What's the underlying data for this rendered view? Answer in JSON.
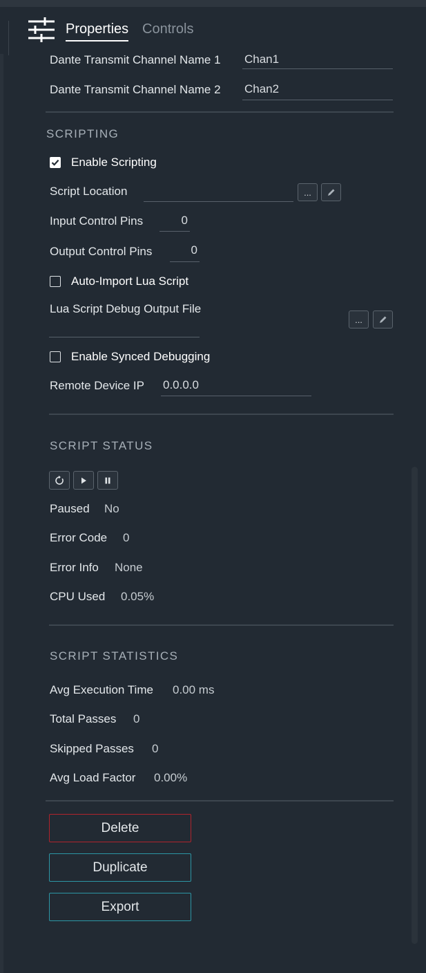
{
  "header": {
    "tabs": [
      "Properties",
      "Controls"
    ],
    "icon": "sliders-icon"
  },
  "dante": {
    "channel1": {
      "label": "Dante Transmit Channel Name 1",
      "value": "Chan1"
    },
    "channel2": {
      "label": "Dante Transmit Channel Name 2",
      "value": "Chan2"
    }
  },
  "scripting": {
    "title": "SCRIPTING",
    "enable_scripting": {
      "label": "Enable Scripting",
      "checked": true
    },
    "script_location": {
      "label": "Script Location",
      "value": "",
      "browse": "...",
      "edit_icon": "pencil-icon"
    },
    "input_pins": {
      "label": "Input Control Pins",
      "value": "0"
    },
    "output_pins": {
      "label": "Output Control Pins",
      "value": "0"
    },
    "auto_import": {
      "label": "Auto-Import Lua Script",
      "checked": false
    },
    "debug_output": {
      "label": "Lua Script Debug Output File",
      "value": "",
      "browse": "...",
      "edit_icon": "pencil-icon"
    },
    "synced_debugging": {
      "label": "Enable Synced Debugging",
      "checked": false
    },
    "remote_ip": {
      "label": "Remote Device IP",
      "value": "0.0.0.0"
    }
  },
  "status": {
    "title": "SCRIPT STATUS",
    "controls": [
      "reload-icon",
      "play-icon",
      "pause-icon"
    ],
    "paused": {
      "label": "Paused",
      "value": "No"
    },
    "error_code": {
      "label": "Error Code",
      "value": "0"
    },
    "error_info": {
      "label": "Error Info",
      "value": "None"
    },
    "cpu_used": {
      "label": "CPU Used",
      "value": "0.05%"
    }
  },
  "statistics": {
    "title": "SCRIPT STATISTICS",
    "avg_exec": {
      "label": "Avg Execution Time",
      "value": "0.00 ms"
    },
    "total_passes": {
      "label": "Total Passes",
      "value": "0"
    },
    "skipped_passes": {
      "label": "Skipped Passes",
      "value": "0"
    },
    "avg_load": {
      "label": "Avg Load Factor",
      "value": "0.00%"
    }
  },
  "actions": {
    "delete": "Delete",
    "duplicate": "Duplicate",
    "export": "Export"
  },
  "colors": {
    "background": "#222a33",
    "delete_border": "#b1232c",
    "accent_border": "#2c97a6"
  }
}
